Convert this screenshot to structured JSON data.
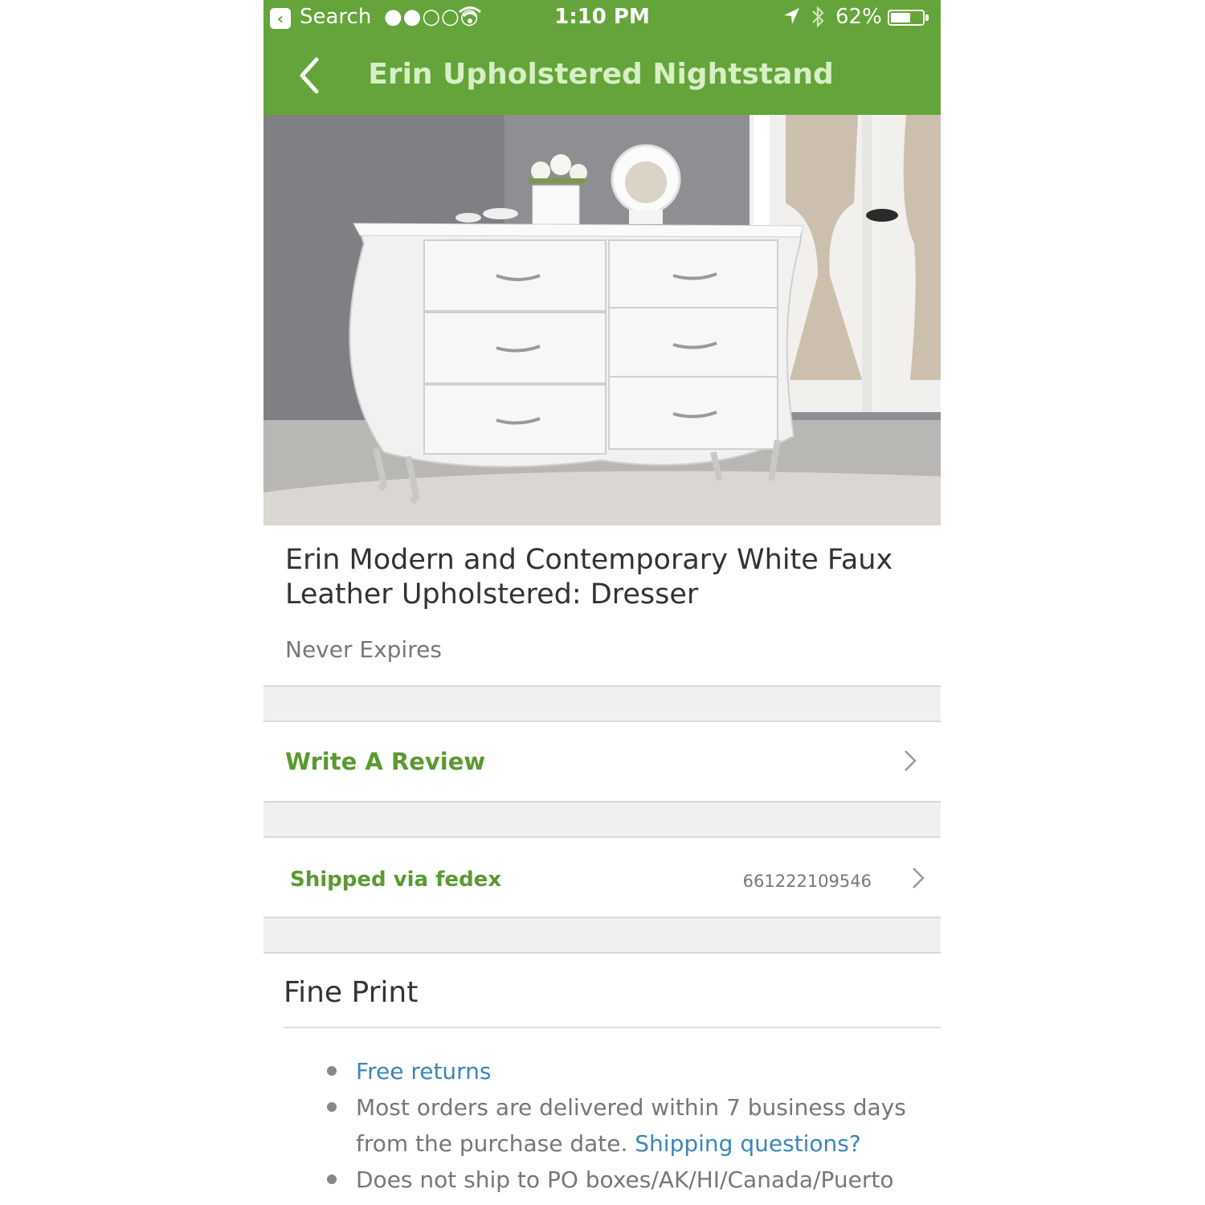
{
  "status_bar": {
    "back_app_label": "Search",
    "signal": "●●○○○",
    "time": "1:10 PM",
    "battery_text": "62%",
    "battery_level": 0.62
  },
  "nav": {
    "title": "Erin Upholstered Nightstand"
  },
  "product": {
    "title": "Erin Modern and Contemporary White Faux Leather Upholstered: Dresser",
    "expires": "Never Expires"
  },
  "actions": {
    "write_review": "Write A Review",
    "shipping_label": "Shipped via fedex",
    "tracking_number": "661222109546"
  },
  "fine_print": {
    "heading": "Fine Print",
    "item1_link": "Free returns",
    "item2_text": "Most orders are delivered within 7 business days from the purchase date. ",
    "item2_link": "Shipping questions?",
    "item3_text": "Does not ship to PO boxes/AK/HI/Canada/Puerto"
  },
  "colors": {
    "brand_green": "#64a43a",
    "title_green": "#d7efc4",
    "link_blue": "#3b86b8"
  },
  "icons": [
    "app-back-icon",
    "wifi-icon",
    "location-arrow-icon",
    "bluetooth-icon",
    "battery-icon",
    "back-chevron-icon",
    "chevron-right-icon"
  ]
}
